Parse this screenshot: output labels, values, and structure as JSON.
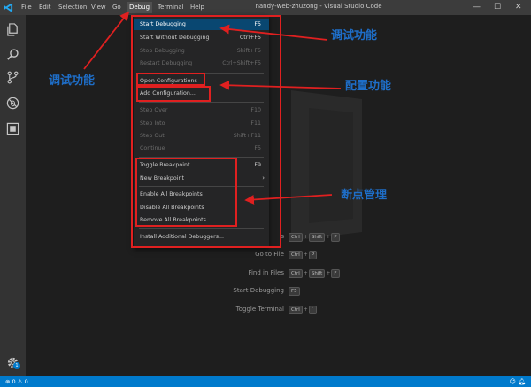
{
  "titlebar": {
    "menus": [
      "File",
      "Edit",
      "Selection",
      "View",
      "Go",
      "Debug",
      "Terminal",
      "Help"
    ],
    "window_title": "nandy-web-zhuzong - Visual Studio Code",
    "minimize": "—",
    "maximize": "☐",
    "close": "✕"
  },
  "debug_menu": {
    "start_debugging": {
      "label": "Start Debugging",
      "shortcut": "F5"
    },
    "start_without_debugging": {
      "label": "Start Without Debugging",
      "shortcut": "Ctrl+F5"
    },
    "stop_debugging": {
      "label": "Stop Debugging",
      "shortcut": "Shift+F5"
    },
    "restart_debugging": {
      "label": "Restart Debugging",
      "shortcut": "Ctrl+Shift+F5"
    },
    "open_configurations": {
      "label": "Open Configurations"
    },
    "add_configuration": {
      "label": "Add Configuration..."
    },
    "step_over": {
      "label": "Step Over",
      "shortcut": "F10"
    },
    "step_into": {
      "label": "Step Into",
      "shortcut": "F11"
    },
    "step_out": {
      "label": "Step Out",
      "shortcut": "Shift+F11"
    },
    "continue": {
      "label": "Continue",
      "shortcut": "F5"
    },
    "toggle_breakpoint": {
      "label": "Toggle Breakpoint",
      "shortcut": "F9"
    },
    "new_breakpoint": {
      "label": "New Breakpoint",
      "arrow": "›"
    },
    "enable_all_breakpoints": {
      "label": "Enable All Breakpoints"
    },
    "disable_all_breakpoints": {
      "label": "Disable All Breakpoints"
    },
    "remove_all_breakpoints": {
      "label": "Remove All Breakpoints"
    },
    "install_debuggers": {
      "label": "Install Additional Debuggers..."
    }
  },
  "shortcuts": {
    "partial": {
      "label": "s",
      "keys": [
        "Ctrl",
        "Shift",
        "P"
      ]
    },
    "go_to_file": {
      "label": "Go to File",
      "keys": [
        "Ctrl",
        "P"
      ]
    },
    "find_in_files": {
      "label": "Find in Files",
      "keys": [
        "Ctrl",
        "Shift",
        "F"
      ]
    },
    "start_debugging": {
      "label": "Start Debugging",
      "keys": [
        "F5"
      ]
    },
    "toggle_terminal": {
      "label": "Toggle Terminal",
      "keys": [
        "Ctrl",
        "`"
      ]
    }
  },
  "annotations": {
    "debug_features_left": "调试功能",
    "debug_features_right": "调试功能",
    "config_features": "配置功能",
    "breakpoint_management": "断点管理"
  },
  "statusbar": {
    "errors": "0",
    "warnings": "0",
    "settings_badge": "1"
  },
  "colors": {
    "accent": "#007acc",
    "annotation_red": "#e02020",
    "annotation_blue": "#1e6ec8"
  }
}
